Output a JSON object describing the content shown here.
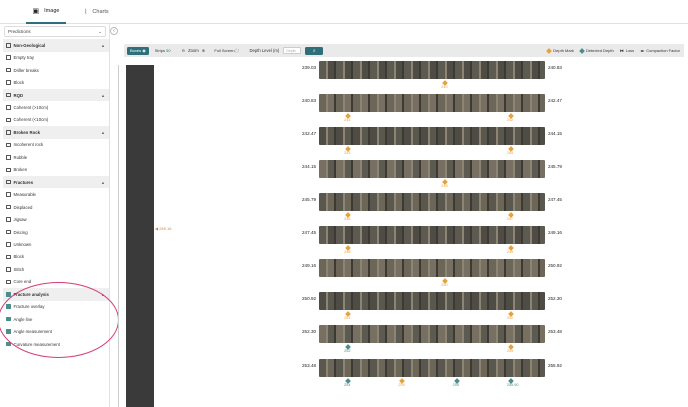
{
  "tabs": [
    {
      "label": "Image"
    },
    {
      "label": "Charts"
    }
  ],
  "sidebar": {
    "dropdown": "Predictions",
    "items": [
      {
        "label": "Non-Geological",
        "group": true,
        "checked": false
      },
      {
        "label": "Empty tray",
        "group": false,
        "checked": false
      },
      {
        "label": "Driller breaks",
        "group": false,
        "checked": false
      },
      {
        "label": "Block",
        "group": false,
        "checked": false
      },
      {
        "label": "RQD",
        "group": true,
        "checked": false
      },
      {
        "label": "Coherent (>10cm)",
        "group": false,
        "checked": false
      },
      {
        "label": "Coherent (<10cm)",
        "group": false,
        "checked": false
      },
      {
        "label": "Broken Rock",
        "group": true,
        "checked": false
      },
      {
        "label": "Incoherent rock",
        "group": false,
        "checked": false
      },
      {
        "label": "Rubble",
        "group": false,
        "checked": false
      },
      {
        "label": "Broken",
        "group": false,
        "checked": false
      },
      {
        "label": "Fractures",
        "group": true,
        "checked": false
      },
      {
        "label": "Measurable",
        "group": false,
        "checked": false
      },
      {
        "label": "Displaced",
        "group": false,
        "checked": false
      },
      {
        "label": "Jigsaw",
        "group": false,
        "checked": false
      },
      {
        "label": "Discing",
        "group": false,
        "checked": false
      },
      {
        "label": "Unknown",
        "group": false,
        "checked": false
      },
      {
        "label": "Block",
        "group": false,
        "checked": false
      },
      {
        "label": "Stitch",
        "group": false,
        "checked": false
      },
      {
        "label": "Core end",
        "group": false,
        "checked": false
      },
      {
        "label": "Fracture analysis",
        "group": true,
        "checked": true
      },
      {
        "label": "Fracture overlay",
        "group": false,
        "checked": true
      },
      {
        "label": "Angle line",
        "group": false,
        "checked": true
      },
      {
        "label": "Angle measurement",
        "group": false,
        "checked": true
      },
      {
        "label": "Curvature measurement",
        "group": false,
        "checked": true
      }
    ]
  },
  "toolbar": {
    "boxes": "Boxes",
    "strips": "Strips",
    "strips_count": "50",
    "zoom": "Zoom",
    "fullscreen": "Full Screen",
    "depth_level": "Depth Level (m)",
    "depth_placeholder": "Depth",
    "legend": [
      "Depth Mark",
      "Detected Depth",
      "Loss",
      "Compaction Factor"
    ]
  },
  "colors": {
    "accent": "#2f6f7a",
    "depth_mark": "#e6a13b",
    "detected": "#4c8e8a",
    "annotation": "#d63b7a"
  },
  "strip": {
    "top_label": "239.03",
    "marker": "249.16"
  },
  "rows": [
    {
      "start": "239.03",
      "end": "240.83",
      "marks": [
        {
          "t": "o",
          "v": "240"
        }
      ]
    },
    {
      "start": "240.83",
      "end": "242.47",
      "marks": [
        {
          "t": "o",
          "v": "241"
        },
        {
          "t": "o",
          "v": "242"
        }
      ]
    },
    {
      "start": "242.47",
      "end": "244.15",
      "marks": [
        {
          "t": "o",
          "v": "243"
        },
        {
          "t": "o",
          "v": "244"
        }
      ]
    },
    {
      "start": "244.15",
      "end": "245.79",
      "marks": [
        {
          "t": "o",
          "v": "245"
        }
      ]
    },
    {
      "start": "245.79",
      "end": "247.45",
      "marks": [
        {
          "t": "o",
          "v": "246"
        },
        {
          "t": "o",
          "v": "247"
        }
      ]
    },
    {
      "start": "247.45",
      "end": "249.16",
      "marks": [
        {
          "t": "o",
          "v": "248"
        },
        {
          "t": "o",
          "v": "249"
        }
      ]
    },
    {
      "start": "249.16",
      "end": "250.92",
      "marks": [
        {
          "t": "o",
          "v": "250"
        }
      ]
    },
    {
      "start": "250.92",
      "end": "252.30",
      "marks": [
        {
          "t": "o",
          "v": "251"
        },
        {
          "t": "o",
          "v": "252"
        }
      ]
    },
    {
      "start": "252.30",
      "end": "253.48",
      "marks": [
        {
          "t": "t",
          "v": "252"
        },
        {
          "t": "o",
          "v": "253"
        }
      ]
    },
    {
      "start": "253.48",
      "end": "255.92",
      "marks": [
        {
          "t": "t",
          "v": "254"
        },
        {
          "t": "o",
          "v": "254"
        },
        {
          "t": "t",
          "v": "255"
        },
        {
          "t": "t",
          "v": "255.90"
        }
      ]
    }
  ]
}
